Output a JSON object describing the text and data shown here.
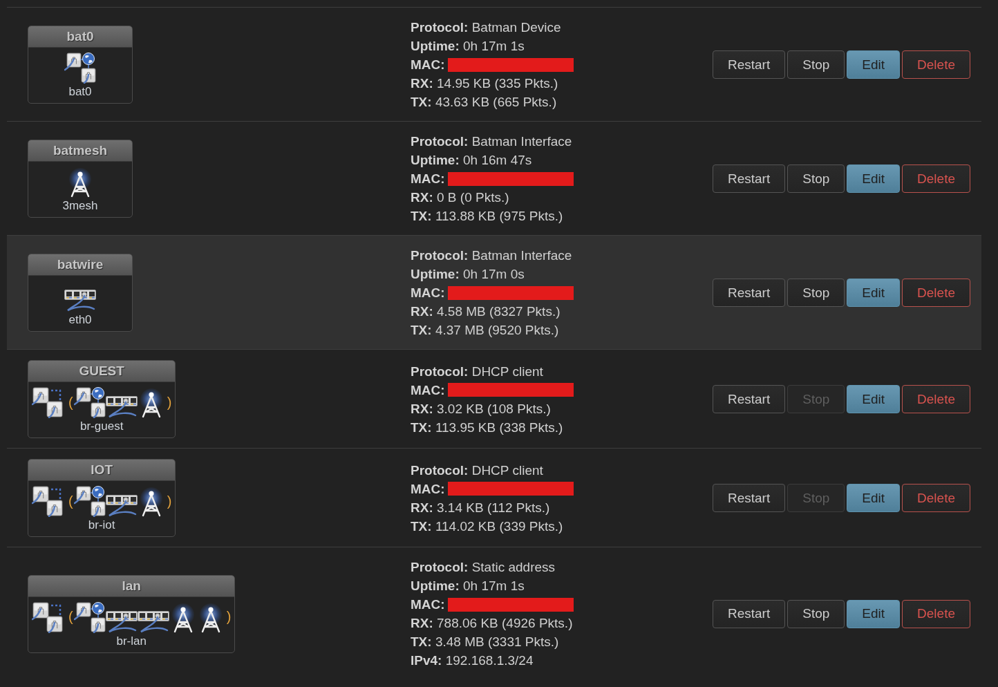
{
  "interfaces": [
    {
      "highlighted": false,
      "badge": {
        "title": "bat0",
        "device": "bat0",
        "bridge": false,
        "members": [
          {
            "kind": "virtual"
          }
        ]
      },
      "details": [
        {
          "kind": "text",
          "label": "Protocol:",
          "value": "Batman Device"
        },
        {
          "kind": "text",
          "label": "Uptime:",
          "value": "0h 17m 1s"
        },
        {
          "kind": "redacted",
          "label": "MAC:"
        },
        {
          "kind": "text",
          "label": "RX:",
          "value": "14.95 KB (335 Pkts.)"
        },
        {
          "kind": "text",
          "label": "TX:",
          "value": "43.63 KB (665 Pkts.)"
        }
      ],
      "actions": [
        {
          "label": "Restart",
          "kind": "default",
          "disabled": false
        },
        {
          "label": "Stop",
          "kind": "default",
          "disabled": false
        },
        {
          "label": "Edit",
          "kind": "primary",
          "disabled": false
        },
        {
          "label": "Delete",
          "kind": "danger",
          "disabled": false
        }
      ]
    },
    {
      "highlighted": false,
      "badge": {
        "title": "batmesh",
        "device": "3mesh",
        "bridge": false,
        "members": [
          {
            "kind": "wifi"
          }
        ]
      },
      "details": [
        {
          "kind": "text",
          "label": "Protocol:",
          "value": "Batman Interface"
        },
        {
          "kind": "text",
          "label": "Uptime:",
          "value": "0h 16m 47s"
        },
        {
          "kind": "redacted",
          "label": "MAC:"
        },
        {
          "kind": "text",
          "label": "RX:",
          "value": "0 B (0 Pkts.)"
        },
        {
          "kind": "text",
          "label": "TX:",
          "value": "113.88 KB (975 Pkts.)"
        }
      ],
      "actions": [
        {
          "label": "Restart",
          "kind": "default",
          "disabled": false
        },
        {
          "label": "Stop",
          "kind": "default",
          "disabled": false
        },
        {
          "label": "Edit",
          "kind": "primary",
          "disabled": false
        },
        {
          "label": "Delete",
          "kind": "danger",
          "disabled": false
        }
      ]
    },
    {
      "highlighted": true,
      "badge": {
        "title": "batwire",
        "device": "eth0",
        "bridge": false,
        "members": [
          {
            "kind": "switch"
          }
        ]
      },
      "details": [
        {
          "kind": "text",
          "label": "Protocol:",
          "value": "Batman Interface"
        },
        {
          "kind": "text",
          "label": "Uptime:",
          "value": "0h 17m 0s"
        },
        {
          "kind": "redacted",
          "label": "MAC:"
        },
        {
          "kind": "text",
          "label": "RX:",
          "value": "4.58 MB (8327 Pkts.)"
        },
        {
          "kind": "text",
          "label": "TX:",
          "value": "4.37 MB (9520 Pkts.)"
        }
      ],
      "actions": [
        {
          "label": "Restart",
          "kind": "default",
          "disabled": false
        },
        {
          "label": "Stop",
          "kind": "default",
          "disabled": false
        },
        {
          "label": "Edit",
          "kind": "primary",
          "disabled": false
        },
        {
          "label": "Delete",
          "kind": "danger",
          "disabled": false
        }
      ]
    },
    {
      "highlighted": false,
      "badge": {
        "title": "GUEST",
        "device": "br-guest",
        "bridge": true,
        "bracket_open": "(",
        "bracket_close": ")",
        "members": [
          {
            "kind": "virtual"
          },
          {
            "kind": "switch"
          },
          {
            "kind": "wifi"
          }
        ]
      },
      "details": [
        {
          "kind": "text",
          "label": "Protocol:",
          "value": "DHCP client"
        },
        {
          "kind": "redacted",
          "label": "MAC:"
        },
        {
          "kind": "text",
          "label": "RX:",
          "value": "3.02 KB (108 Pkts.)"
        },
        {
          "kind": "text",
          "label": "TX:",
          "value": "113.95 KB (338 Pkts.)"
        }
      ],
      "actions": [
        {
          "label": "Restart",
          "kind": "default",
          "disabled": false
        },
        {
          "label": "Stop",
          "kind": "default",
          "disabled": true
        },
        {
          "label": "Edit",
          "kind": "primary",
          "disabled": false
        },
        {
          "label": "Delete",
          "kind": "danger",
          "disabled": false
        }
      ]
    },
    {
      "highlighted": false,
      "badge": {
        "title": "IOT",
        "device": "br-iot",
        "bridge": true,
        "bracket_open": "(",
        "bracket_close": ")",
        "members": [
          {
            "kind": "virtual"
          },
          {
            "kind": "switch"
          },
          {
            "kind": "wifi"
          }
        ]
      },
      "details": [
        {
          "kind": "text",
          "label": "Protocol:",
          "value": "DHCP client"
        },
        {
          "kind": "redacted",
          "label": "MAC:"
        },
        {
          "kind": "text",
          "label": "RX:",
          "value": "3.14 KB (112 Pkts.)"
        },
        {
          "kind": "text",
          "label": "TX:",
          "value": "114.02 KB (339 Pkts.)"
        }
      ],
      "actions": [
        {
          "label": "Restart",
          "kind": "default",
          "disabled": false
        },
        {
          "label": "Stop",
          "kind": "default",
          "disabled": true
        },
        {
          "label": "Edit",
          "kind": "primary",
          "disabled": false
        },
        {
          "label": "Delete",
          "kind": "danger",
          "disabled": false
        }
      ]
    },
    {
      "highlighted": false,
      "badge": {
        "title": "lan",
        "device": "br-lan",
        "bridge": true,
        "bracket_open": "(",
        "bracket_close": ")",
        "members": [
          {
            "kind": "virtual"
          },
          {
            "kind": "switch"
          },
          {
            "kind": "switch"
          },
          {
            "kind": "wifi"
          },
          {
            "kind": "wifi"
          }
        ]
      },
      "details": [
        {
          "kind": "text",
          "label": "Protocol:",
          "value": "Static address"
        },
        {
          "kind": "text",
          "label": "Uptime:",
          "value": "0h 17m 1s"
        },
        {
          "kind": "redacted",
          "label": "MAC:"
        },
        {
          "kind": "text",
          "label": "RX:",
          "value": "788.06 KB (4926 Pkts.)"
        },
        {
          "kind": "text",
          "label": "TX:",
          "value": "3.48 MB (3331 Pkts.)"
        },
        {
          "kind": "text",
          "label": "IPv4:",
          "value": "192.168.1.3/24"
        }
      ],
      "actions": [
        {
          "label": "Restart",
          "kind": "default",
          "disabled": false
        },
        {
          "label": "Stop",
          "kind": "default",
          "disabled": false
        },
        {
          "label": "Edit",
          "kind": "primary",
          "disabled": false
        },
        {
          "label": "Delete",
          "kind": "danger",
          "disabled": false
        }
      ]
    }
  ]
}
